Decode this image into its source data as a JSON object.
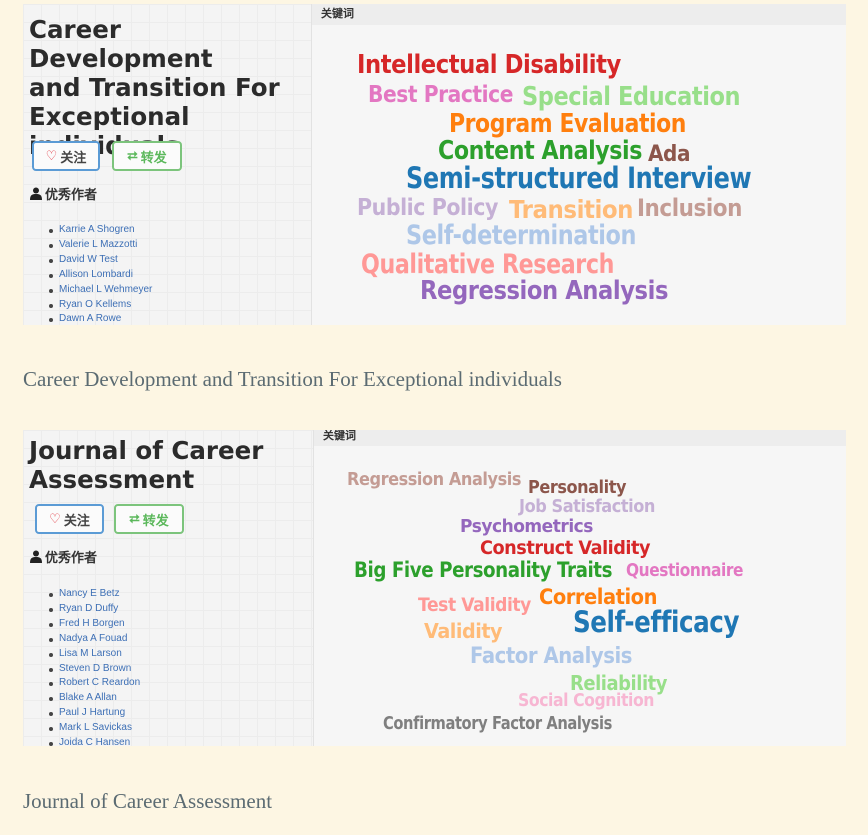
{
  "journals": [
    {
      "title": "Career Development\nand Transition For\nExceptional\nindividuals",
      "follow_label": "关注",
      "share_label": "转发",
      "authors_label": "优秀作者",
      "keywords_label": "关键词",
      "authors": [
        "Karrie A Shogren",
        "Valerie L Mazzotti",
        "David W Test",
        "Allison Lombardi",
        "Michael L Wehmeyer",
        "Ryan O Kellems",
        "Dawn A Rowe"
      ],
      "keywords": [
        {
          "text": "Intellectual Disability",
          "color": "#d62728"
        },
        {
          "text": "Best Practice",
          "color": "#e377c2"
        },
        {
          "text": "Special Education",
          "color": "#98df8a"
        },
        {
          "text": "Program Evaluation",
          "color": "#ff7f0e"
        },
        {
          "text": "Content Analysis",
          "color": "#2ca02c"
        },
        {
          "text": "Ada",
          "color": "#8c564b"
        },
        {
          "text": "Semi-structured Interview",
          "color": "#1f77b4"
        },
        {
          "text": "Public Policy",
          "color": "#c5b0d5"
        },
        {
          "text": "Transition",
          "color": "#ffbb78"
        },
        {
          "text": "Inclusion",
          "color": "#c49c94"
        },
        {
          "text": "Self-determination",
          "color": "#aec7e8"
        },
        {
          "text": "Qualitative Research",
          "color": "#ff9896"
        },
        {
          "text": "Regression Analysis",
          "color": "#9467bd"
        }
      ],
      "caption": "Career Development and Transition For Exceptional individuals"
    },
    {
      "title": "Journal of Career\nAssessment",
      "follow_label": "关注",
      "share_label": "转发",
      "authors_label": "优秀作者",
      "keywords_label": "关键词",
      "authors": [
        "Nancy E Betz",
        "Ryan D Duffy",
        "Fred H Borgen",
        "Nadya A Fouad",
        "Lisa M Larson",
        "Steven D Brown",
        "Robert C Reardon",
        "Blake A Allan",
        "Paul J Hartung",
        "Mark L Savickas",
        "Joida C Hansen"
      ],
      "keywords": [
        {
          "text": "Regression Analysis",
          "color": "#c49c94"
        },
        {
          "text": "Personality",
          "color": "#8c564b"
        },
        {
          "text": "Job Satisfaction",
          "color": "#c5b0d5"
        },
        {
          "text": "Psychometrics",
          "color": "#9467bd"
        },
        {
          "text": "Construct Validity",
          "color": "#d62728"
        },
        {
          "text": "Big Five Personality Traits",
          "color": "#2ca02c"
        },
        {
          "text": "Questionnaire",
          "color": "#e377c2"
        },
        {
          "text": "Test Validity",
          "color": "#ff9896"
        },
        {
          "text": "Correlation",
          "color": "#ff7f0e"
        },
        {
          "text": "Self-efficacy",
          "color": "#1f77b4"
        },
        {
          "text": "Validity",
          "color": "#ffbb78"
        },
        {
          "text": "Factor Analysis",
          "color": "#aec7e8"
        },
        {
          "text": "Reliability",
          "color": "#98df8a"
        },
        {
          "text": "Social Cognition",
          "color": "#f7b6d2"
        },
        {
          "text": "Confirmatory Factor Analysis",
          "color": "#7f7f7f"
        }
      ],
      "caption": "Journal of Career Assessment"
    }
  ]
}
